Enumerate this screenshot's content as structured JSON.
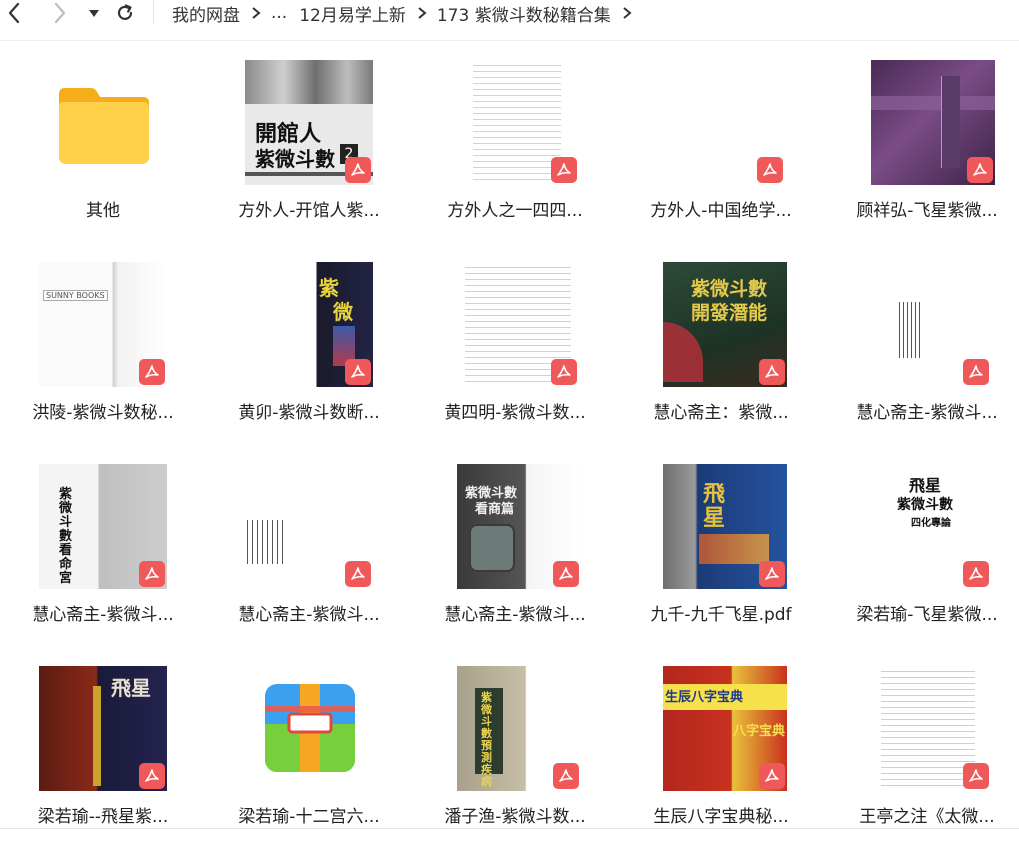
{
  "breadcrumb": {
    "items": [
      "我的网盘",
      "...",
      "12月易学上新",
      "173 紫微斗数秘籍合集"
    ]
  },
  "files": [
    {
      "name": "其他",
      "type": "folder"
    },
    {
      "name": "方外人-开馆人紫...",
      "type": "pdf",
      "cover_text": [
        "開館人",
        "紫微斗數",
        "2"
      ]
    },
    {
      "name": "方外人之一四四...",
      "type": "pdf"
    },
    {
      "name": "方外人-中国绝学...",
      "type": "pdf"
    },
    {
      "name": "顾祥弘-飞星紫微...",
      "type": "pdf"
    },
    {
      "name": "洪陵-紫微斗数秘...",
      "type": "pdf",
      "cover_text": [
        "SUNNY BOOKS"
      ]
    },
    {
      "name": "黄卯-紫微斗数断...",
      "type": "pdf",
      "cover_text": [
        "紫",
        "微"
      ]
    },
    {
      "name": "黄四明-紫微斗数...",
      "type": "pdf"
    },
    {
      "name": "慧心斋主：紫微...",
      "type": "pdf",
      "cover_text": [
        "紫微斗數",
        "開發潛能"
      ]
    },
    {
      "name": "慧心斋主-紫微斗...",
      "type": "pdf"
    },
    {
      "name": "慧心斋主-紫微斗...",
      "type": "pdf",
      "cover_text": [
        "紫微斗數看命宮"
      ]
    },
    {
      "name": "慧心斋主-紫微斗...",
      "type": "pdf"
    },
    {
      "name": "慧心斋主-紫微斗...",
      "type": "pdf",
      "cover_text": [
        "紫微斗數",
        "看商篇"
      ]
    },
    {
      "name": "九千-九千飞星.pdf",
      "type": "pdf",
      "cover_text": [
        "飛星"
      ]
    },
    {
      "name": "梁若瑜-飞星紫微...",
      "type": "pdf",
      "cover_text": [
        "飛星",
        "紫微斗數",
        "四化專論"
      ]
    },
    {
      "name": "梁若瑜--飛星紫...",
      "type": "pdf",
      "cover_text": [
        "飛星"
      ]
    },
    {
      "name": "梁若瑜-十二宫六...",
      "type": "archive"
    },
    {
      "name": "潘子渔-紫微斗数...",
      "type": "pdf",
      "cover_text": [
        "紫微斗數預測疾病"
      ]
    },
    {
      "name": "生辰八字宝典秘...",
      "type": "pdf",
      "cover_text": [
        "生辰八字宝典",
        "八字宝典"
      ]
    },
    {
      "name": "王亭之注《太微...",
      "type": "pdf"
    }
  ],
  "colors": {
    "pdf_badge": "#f0595a",
    "folder": "#ffc933",
    "text": "#222222"
  }
}
